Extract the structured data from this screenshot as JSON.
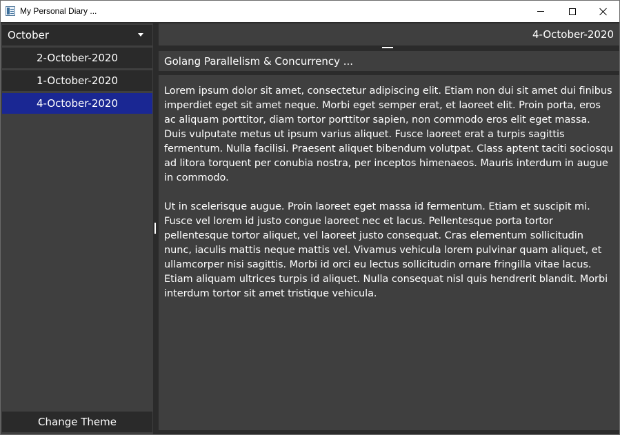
{
  "window": {
    "title": "My Personal Diary ...",
    "icon": "app-icon",
    "controls": {
      "minimize": "minimize-icon",
      "maximize": "maximize-icon",
      "close": "close-icon"
    }
  },
  "sidebar": {
    "month_select": {
      "value": "October",
      "icon": "chevron-down-icon"
    },
    "entries": [
      {
        "label": "2-October-2020",
        "selected": false
      },
      {
        "label": "1-October-2020",
        "selected": false
      },
      {
        "label": "4-October-2020",
        "selected": true
      }
    ],
    "change_theme_label": "Change Theme"
  },
  "editor": {
    "date": "4-October-2020",
    "title": "Golang Parallelism & Concurrency ...",
    "paragraphs": [
      "Lorem ipsum dolor sit amet, consectetur adipiscing elit. Etiam non dui sit amet dui finibus imperdiet eget sit amet neque. Morbi eget semper erat, et laoreet elit. Proin porta, eros ac aliquam porttitor, diam tortor porttitor sapien, non commodo eros elit eget massa. Duis vulputate metus ut ipsum varius aliquet. Fusce laoreet erat a turpis sagittis fermentum. Nulla facilisi. Praesent aliquet bibendum volutpat. Class aptent taciti sociosqu ad litora torquent per conubia nostra, per inceptos himenaeos. Mauris interdum in augue in commodo.",
      "Ut in scelerisque augue. Proin laoreet eget massa id fermentum. Etiam et suscipit mi. Fusce vel lorem id justo congue laoreet nec et lacus. Pellentesque porta tortor pellentesque tortor aliquet, vel laoreet justo consequat. Cras elementum sollicitudin nunc, iaculis mattis neque mattis vel. Vivamus vehicula lorem pulvinar quam aliquet, et ullamcorper nisi sagittis. Morbi id orci eu lectus sollicitudin ornare fringilla vitae lacus. Etiam aliquam ultrices turpis id aliquet. Nulla consequat nisl quis hendrerit blandit. Morbi interdum tortor sit amet tristique vehicula."
    ]
  },
  "colors": {
    "panel": "#3f3f3f",
    "background": "#2b2b2b",
    "item": "#2a2a2a",
    "selected": "#1a2793",
    "text": "#ffffff"
  }
}
